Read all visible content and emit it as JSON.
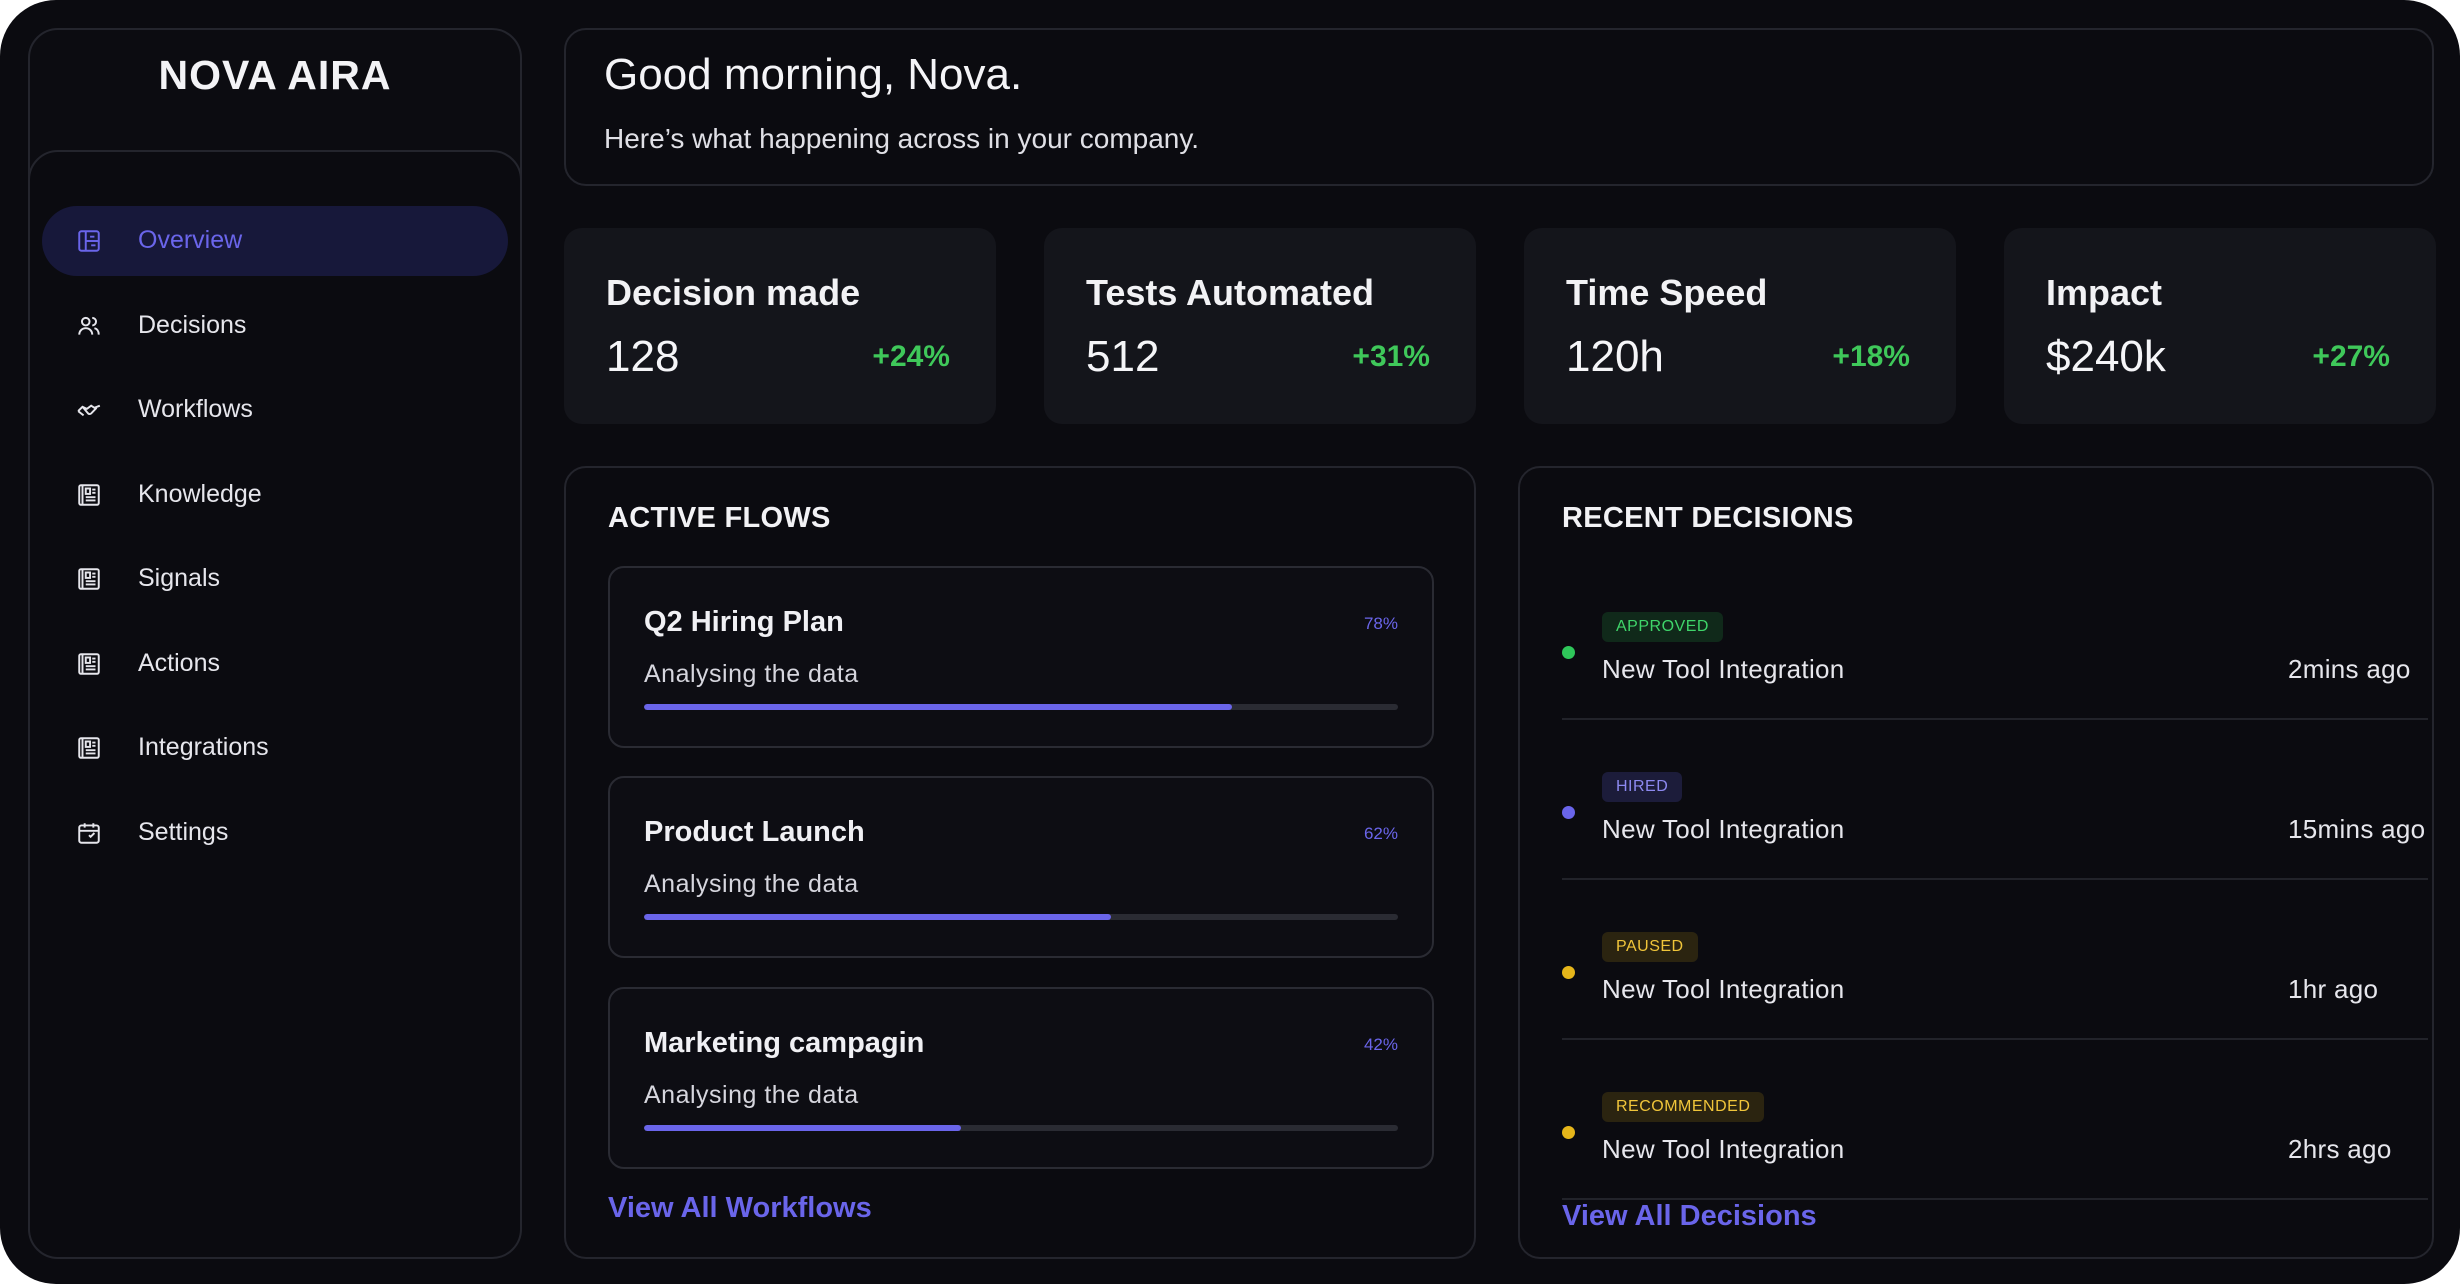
{
  "brand": "NOVA AIRA",
  "sidebar": {
    "items": [
      {
        "label": "Overview",
        "icon": "layout-icon",
        "active": true
      },
      {
        "label": "Decisions",
        "icon": "users-icon",
        "active": false
      },
      {
        "label": "Workflows",
        "icon": "handshake-icon",
        "active": false
      },
      {
        "label": "Knowledge",
        "icon": "document-icon",
        "active": false
      },
      {
        "label": "Signals",
        "icon": "document-icon",
        "active": false
      },
      {
        "label": "Actions",
        "icon": "document-icon",
        "active": false
      },
      {
        "label": "Integrations",
        "icon": "document-icon",
        "active": false
      },
      {
        "label": "Settings",
        "icon": "calendar-icon",
        "active": false
      }
    ]
  },
  "header": {
    "greeting": "Good morning, Nova.",
    "subtitle": "Here’s what happening across in your company."
  },
  "stats": [
    {
      "title": "Decision made",
      "value": "128",
      "change": "+24%"
    },
    {
      "title": "Tests Automated",
      "value": "512",
      "change": "+31%"
    },
    {
      "title": "Time Speed",
      "value": "120h",
      "change": "+18%"
    },
    {
      "title": "Impact",
      "value": "$240k",
      "change": "+27%"
    }
  ],
  "flows": {
    "title": "ACTIVE FLOWS",
    "items": [
      {
        "name": "Q2 Hiring Plan",
        "percent_label": "78%",
        "progress": 0.78,
        "status": "Analysing the data"
      },
      {
        "name": "Product Launch",
        "percent_label": "62%",
        "progress": 0.62,
        "status": "Analysing the data"
      },
      {
        "name": "Marketing campagin",
        "percent_label": "42%",
        "progress": 0.42,
        "status": "Analysing the data"
      }
    ],
    "link": "View All Workflows"
  },
  "decisions": {
    "title": "RECENT DECISIONS",
    "items": [
      {
        "badge": "APPROVED",
        "name": "New Tool Integration",
        "time": "2mins ago",
        "color": "#2fc75a",
        "badge_bg": "#10291a",
        "badge_fg": "#3fd56a"
      },
      {
        "badge": "HIRED",
        "name": "New Tool Integration",
        "time": "15mins ago",
        "color": "#6a65ea",
        "badge_bg": "#1c1c3a",
        "badge_fg": "#8d89f0"
      },
      {
        "badge": "PAUSED",
        "name": "New Tool Integration",
        "time": "1hr ago",
        "color": "#e6b61a",
        "badge_bg": "#2b2410",
        "badge_fg": "#f0c53a"
      },
      {
        "badge": "RECOMMENDED",
        "name": "New Tool Integration",
        "time": "2hrs ago",
        "color": "#e6b61a",
        "badge_bg": "#2b2410",
        "badge_fg": "#f0c53a"
      }
    ],
    "link": "View All Decisions"
  },
  "colors": {
    "background": "#0b0b10",
    "accent": "#6a65ea",
    "positive": "#3fc85a"
  }
}
